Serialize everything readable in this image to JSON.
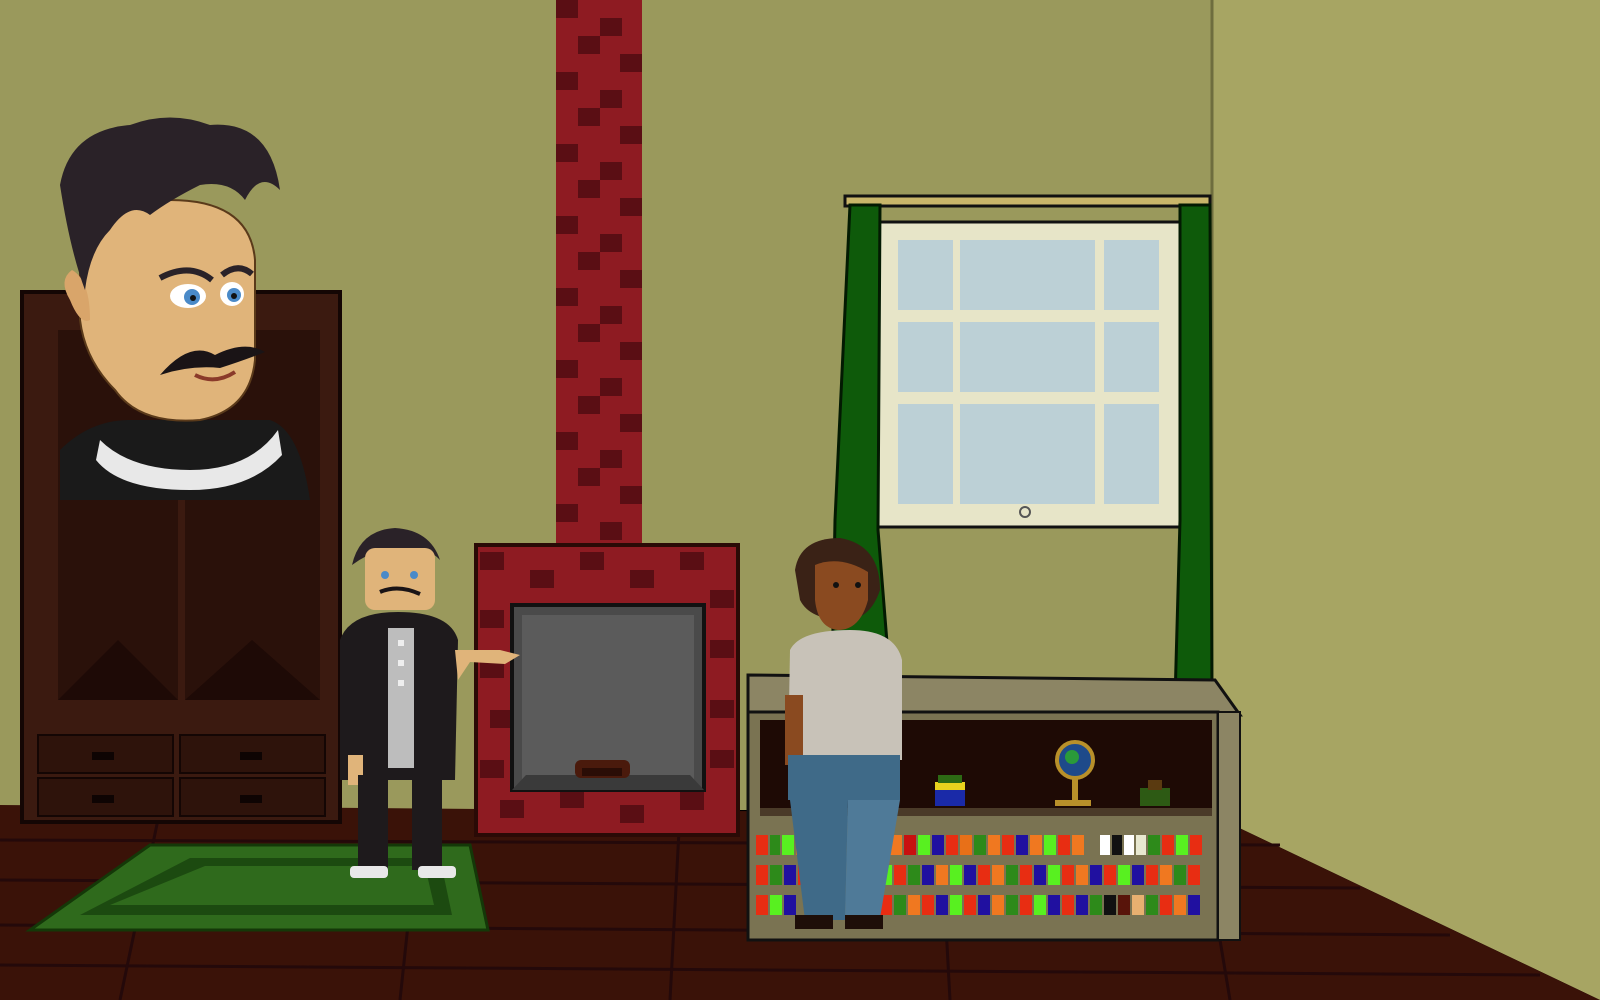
{
  "scene": {
    "name": "living-room",
    "palette": {
      "wall": "#9a995c",
      "wall_side": "#a7a563",
      "floor": "#3a1208",
      "floor_line": "#24090a",
      "brick_a": "#8e1b22",
      "brick_b": "#5a0e14",
      "wardrobe": "#3b1a10",
      "wardrobe_dark": "#2a110a",
      "rug": "#2f6a1c",
      "rug_dark": "#1c4a10",
      "curtain": "#0e5a0a",
      "window_glass": "#bcd0d6",
      "window_frame": "#e7e5c8",
      "cabinet": "#8c8564",
      "shelf_back": "#1e0a05"
    },
    "icons": [
      "speaker-portrait",
      "man-character",
      "woman-character",
      "fireplace",
      "wardrobe",
      "window",
      "bookshelf",
      "globe-ornament"
    ]
  }
}
